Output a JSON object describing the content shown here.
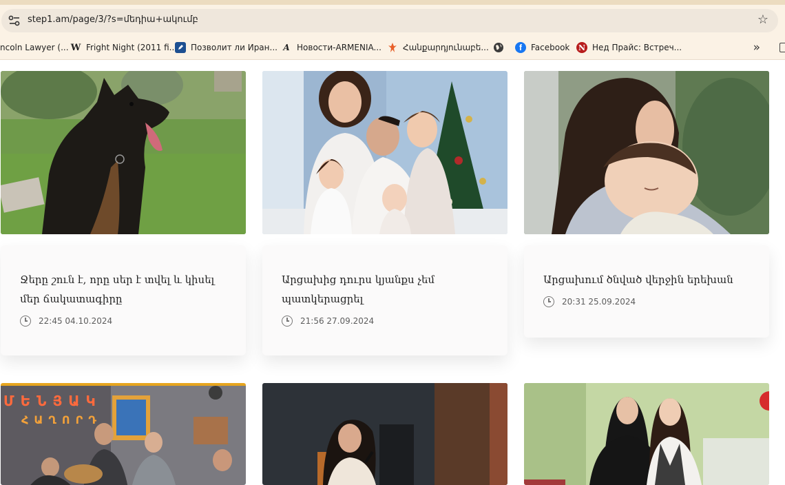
{
  "browser": {
    "url": "step1.am/page/3/?s=մեդիա+ակումբ",
    "bookmarks": [
      {
        "label": "ncoln Lawyer (...",
        "icon": "",
        "icon_color": ""
      },
      {
        "label": "Fright Night (2011 fi...",
        "icon": "W",
        "icon_color": "#ffffff"
      },
      {
        "label": "Позволит ли Иран...",
        "icon": "pen-icon",
        "icon_color": "#1d4f91"
      },
      {
        "label": "Новости-ARMENIA...",
        "icon": "A",
        "icon_color": "#ffffff"
      },
      {
        "label": "Հանքարդյունաբե...",
        "icon": "flame-icon",
        "icon_color": "#e8602a"
      },
      {
        "label": "",
        "icon": "globe-icon",
        "icon_color": "#3c3c3c"
      },
      {
        "label": "Facebook",
        "icon": "facebook-icon",
        "icon_color": "#1877f2"
      },
      {
        "label": "Нед Прайс: Встреч...",
        "icon": "N",
        "icon_color": "#b71c1c"
      }
    ]
  },
  "articles": [
    {
      "title": "Ջերը շուն է, որը սեր է տվել և կիսել մեր ճակատագիրը",
      "time": "22:45 04.10.2024",
      "image": "dog photo"
    },
    {
      "title": "Արցախից դուրս կյանքս չեմ պատկերացրել",
      "time": "21:56 27.09.2024",
      "image": "family with christmas tree"
    },
    {
      "title": "Արցախում ծնված վերջին երեխան",
      "time": "20:31 25.09.2024",
      "image": "mother with sleeping baby"
    }
  ],
  "second_row": {
    "poster_text_1": "ՄԵՆՅԱԿ",
    "poster_text_2": "ՀԱՂՈՐԴ"
  }
}
